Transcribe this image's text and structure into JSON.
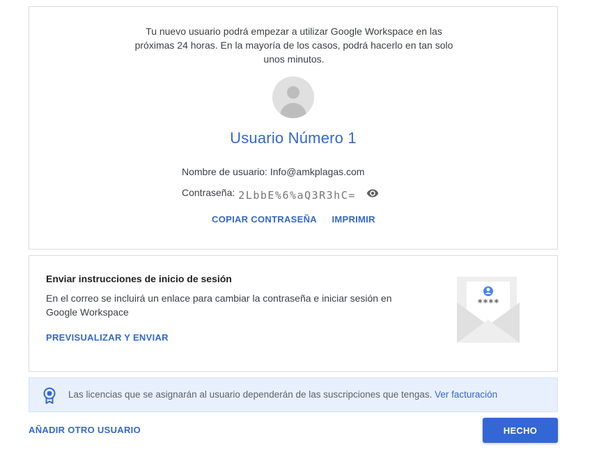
{
  "user_card": {
    "intro_text": "Tu nuevo usuario podrá empezar a utilizar Google Workspace en las próximas 24 horas. En la mayoría de los casos, podrá hacerlo en tan solo unos minutos.",
    "user_name": "Usuario Número 1",
    "username_label": "Nombre de usuario:",
    "username_value": "Info@amkplagas.com",
    "password_label": "Contraseña:",
    "password_value": "2LbbE%6%aQ3R3hC=",
    "copy_password_label": "COPIAR CONTRASEÑA",
    "print_label": "IMPRIMIR",
    "show_password_icon": "eye-icon"
  },
  "signin_card": {
    "title": "Enviar instrucciones de inicio de sesión",
    "description": "En el correo se incluirá un enlace para cambiar la contraseña e iniciar sesión en Google Workspace",
    "preview_send_label": "PREVISUALIZAR Y ENVIAR",
    "illustration_text": "****"
  },
  "license_banner": {
    "icon": "license-badge-icon",
    "text": "Las licencias que se asignarán al usuario dependerán de las suscripciones que tengas.",
    "link_label": "Ver facturación"
  },
  "footer": {
    "add_user_label": "AÑADIR OTRO USUARIO",
    "done_label": "HECHO"
  },
  "colors": {
    "accent": "#3367d6",
    "banner_bg": "#e8f0fe",
    "border": "#dadce0"
  }
}
